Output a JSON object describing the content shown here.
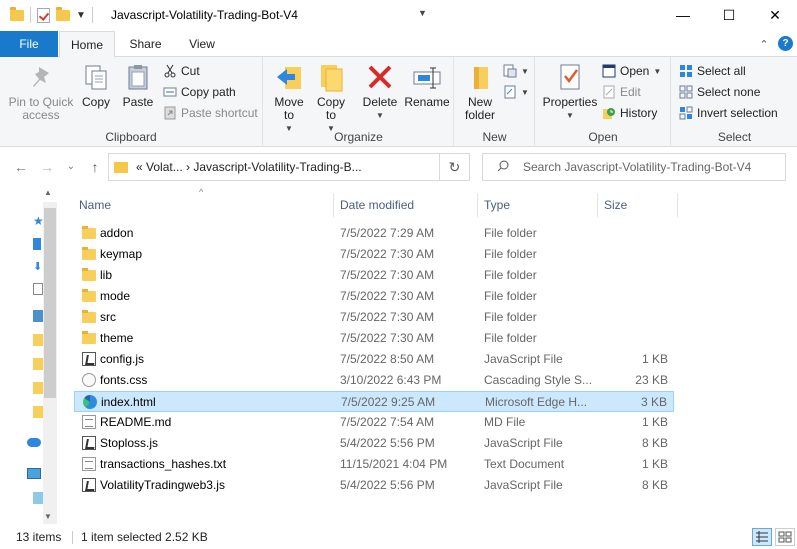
{
  "window": {
    "title": "Javascript-Volatility-Trading-Bot-V4",
    "minimize": "—",
    "maximize": "☐",
    "close": "✕"
  },
  "tabs": {
    "file": "File",
    "home": "Home",
    "share": "Share",
    "view": "View",
    "chevron": "⌃",
    "help": "?"
  },
  "ribbon": {
    "clipboard": {
      "label": "Clipboard",
      "pin": "Pin to Quick access",
      "copy": "Copy",
      "paste": "Paste",
      "cut": "Cut",
      "copy_path": "Copy path",
      "paste_shortcut": "Paste shortcut"
    },
    "organize": {
      "label": "Organize",
      "move_to": "Move to",
      "copy_to": "Copy to",
      "delete": "Delete",
      "rename": "Rename"
    },
    "new": {
      "label": "New",
      "new_folder": "New folder"
    },
    "open": {
      "label": "Open",
      "properties": "Properties",
      "open": "Open",
      "edit": "Edit",
      "history": "History"
    },
    "select": {
      "label": "Select",
      "select_all": "Select all",
      "select_none": "Select none",
      "invert_selection": "Invert selection"
    }
  },
  "nav": {
    "back": "←",
    "forward": "→",
    "recent": "⌄",
    "up": "↑",
    "address": "«  Volat...  ›  Javascript-Volatility-Trading-B...",
    "refresh": "↻",
    "search_placeholder": "Search Javascript-Volatility-Trading-Bot-V4"
  },
  "columns": {
    "name": "Name",
    "date": "Date modified",
    "type": "Type",
    "size": "Size"
  },
  "files": [
    {
      "name": "addon",
      "date": "7/5/2022 7:29 AM",
      "type": "File folder",
      "size": "",
      "icon": "folder-icon"
    },
    {
      "name": "keymap",
      "date": "7/5/2022 7:30 AM",
      "type": "File folder",
      "size": "",
      "icon": "folder-icon"
    },
    {
      "name": "lib",
      "date": "7/5/2022 7:30 AM",
      "type": "File folder",
      "size": "",
      "icon": "folder-icon"
    },
    {
      "name": "mode",
      "date": "7/5/2022 7:30 AM",
      "type": "File folder",
      "size": "",
      "icon": "folder-icon"
    },
    {
      "name": "src",
      "date": "7/5/2022 7:30 AM",
      "type": "File folder",
      "size": "",
      "icon": "folder-icon"
    },
    {
      "name": "theme",
      "date": "7/5/2022 7:30 AM",
      "type": "File folder",
      "size": "",
      "icon": "folder-icon"
    },
    {
      "name": "config.js",
      "date": "7/5/2022 8:50 AM",
      "type": "JavaScript File",
      "size": "1 KB",
      "icon": "js-file-icon"
    },
    {
      "name": "fonts.css",
      "date": "3/10/2022 6:43 PM",
      "type": "Cascading Style S...",
      "size": "23 KB",
      "icon": "css-file-icon"
    },
    {
      "name": "index.html",
      "date": "7/5/2022 9:25 AM",
      "type": "Microsoft Edge H...",
      "size": "3 KB",
      "icon": "edge-file-icon",
      "selected": true
    },
    {
      "name": "README.md",
      "date": "7/5/2022 7:54 AM",
      "type": "MD File",
      "size": "1 KB",
      "icon": "md-file-icon"
    },
    {
      "name": "Stoploss.js",
      "date": "5/4/2022 5:56 PM",
      "type": "JavaScript File",
      "size": "8 KB",
      "icon": "js-file-icon"
    },
    {
      "name": "transactions_hashes.txt",
      "date": "11/15/2021 4:04 PM",
      "type": "Text Document",
      "size": "1 KB",
      "icon": "txt-file-icon"
    },
    {
      "name": "VolatilityTradingweb3.js",
      "date": "5/4/2022 5:56 PM",
      "type": "JavaScript File",
      "size": "8 KB",
      "icon": "js-file-icon"
    }
  ],
  "status": {
    "count": "13 items",
    "selection": "1 item selected  2.52 KB"
  },
  "colors": {
    "accent": "#1979ca",
    "selected_row": "#cce8ff",
    "folder": "#f8cf5a"
  }
}
